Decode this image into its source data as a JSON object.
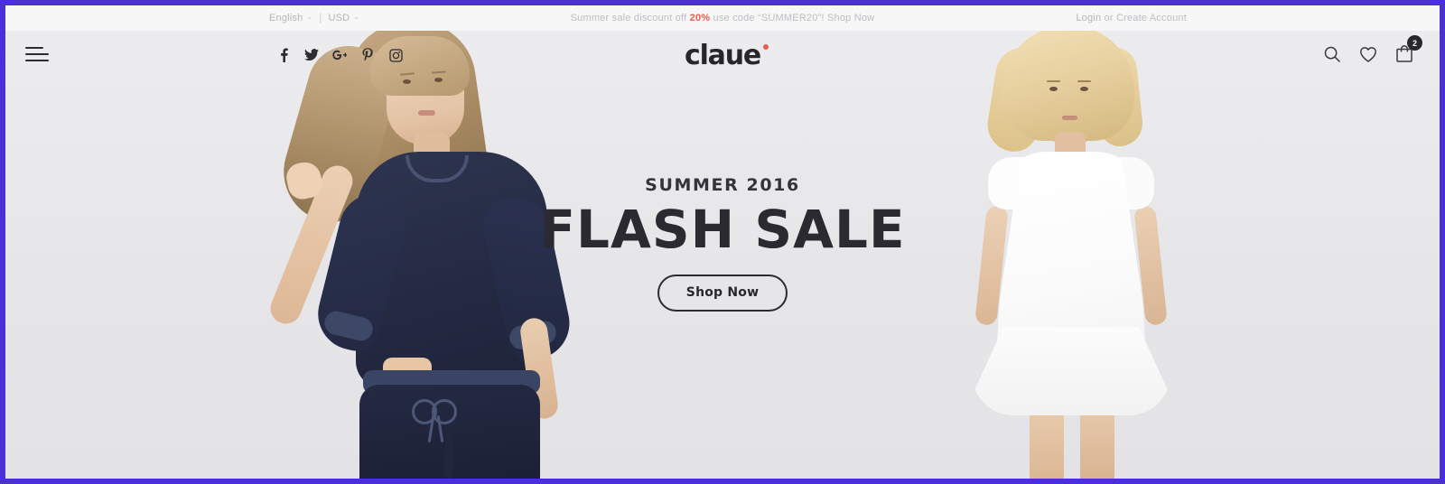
{
  "topbar": {
    "language": "English",
    "currency": "USD",
    "divider": "|",
    "caret": "⌄",
    "promo_prefix": "Summer sale discount off",
    "promo_percent": "20%",
    "promo_middle": "use code “SUMMER20”!",
    "promo_link": "Shop Now",
    "login": "Login",
    "login_suffix": "or Create Account"
  },
  "header": {
    "menu_icon": "hamburger-icon",
    "logo": "claue",
    "socials": [
      {
        "name": "facebook-icon",
        "label": "Facebook"
      },
      {
        "name": "twitter-icon",
        "label": "Twitter"
      },
      {
        "name": "google-plus-icon",
        "label": "Google Plus"
      },
      {
        "name": "pinterest-icon",
        "label": "Pinterest"
      },
      {
        "name": "instagram-icon",
        "label": "Instagram"
      }
    ],
    "search_icon": "search-icon",
    "wishlist_icon": "heart-icon",
    "cart_icon": "cart-icon",
    "cart_count": "2"
  },
  "hero": {
    "eyebrow": "SUMMER 2016",
    "title": "FLASH SALE",
    "button": "Shop Now",
    "left_model_alt": "Model in navy sweatshirt and navy joggers",
    "right_model_alt": "Model in white cap-sleeve flared dress"
  },
  "colors": {
    "frame_border": "#4b30d8",
    "topbar_bg": "#f7f7f8",
    "hero_bg": "#e8e8ea",
    "accent_red": "#e8604c",
    "text_dark": "#2a2a30",
    "muted_text": "#bdbdc2",
    "badge_bg": "#27272c"
  }
}
